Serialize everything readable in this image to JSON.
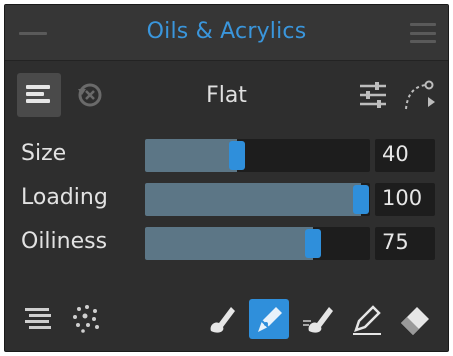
{
  "panel": {
    "title": "Oils & Acrylics"
  },
  "brush": {
    "name": "Flat"
  },
  "properties": [
    {
      "label": "Size",
      "value": "40",
      "level_percent": 40
    },
    {
      "label": "Loading",
      "value": "100",
      "level_percent": 100
    },
    {
      "label": "Oiliness",
      "value": "75",
      "level_percent": 75
    }
  ],
  "tools": {
    "left": [
      "stroke-fill-icon",
      "scatter-icon"
    ],
    "right": [
      "paint-icon",
      "blend-icon",
      "smear-icon",
      "erase-colour-icon",
      "eraser-icon"
    ],
    "active": "blend-icon"
  },
  "colors": {
    "accent": "#2f8fdb",
    "title": "#3a96dc",
    "panel_bg": "#2e2e2e",
    "track_bg": "#1d1d1d",
    "fill": "#5c7686"
  }
}
